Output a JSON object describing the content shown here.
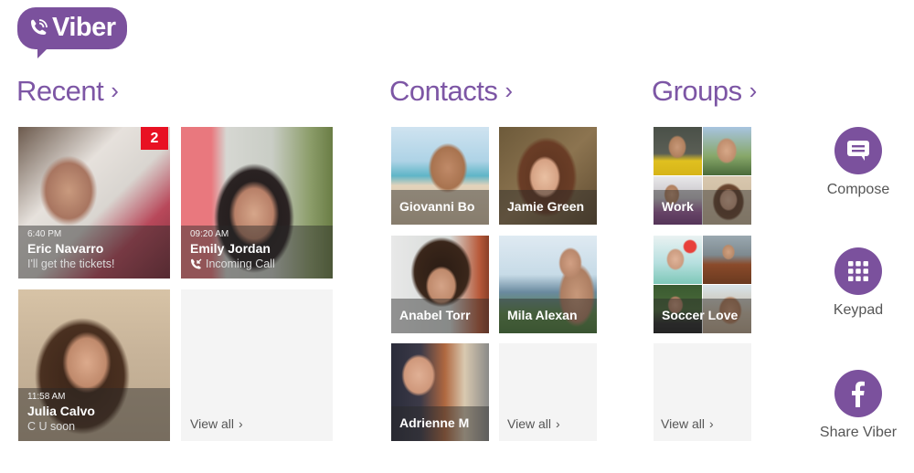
{
  "app": {
    "logo_text": "Viber",
    "brand_color": "#7b519d",
    "accent_badge_color": "#e81123"
  },
  "sections": {
    "recent": {
      "title": "Recent",
      "chevron": "›"
    },
    "contacts": {
      "title": "Contacts",
      "chevron": "›"
    },
    "groups": {
      "title": "Groups",
      "chevron": "›"
    }
  },
  "recent": {
    "items": [
      {
        "time": "6:40 PM",
        "name": "Eric Navarro",
        "message": "I'll get the tickets!",
        "unread_count": "2"
      },
      {
        "time": "09:20 AM",
        "name": "Emily Jordan",
        "message": "Incoming Call",
        "message_icon": "incoming-call-icon"
      },
      {
        "time": "11:58 AM",
        "name": "Julia Calvo",
        "message": "C U soon"
      }
    ],
    "view_all": "View all",
    "view_all_chevron": "›"
  },
  "contacts": {
    "items": [
      {
        "name": "Giovanni Bo"
      },
      {
        "name": "Jamie Green"
      },
      {
        "name": "Anabel Torr"
      },
      {
        "name": "Mila Alexan"
      },
      {
        "name": "Adrienne M"
      }
    ],
    "view_all": "View all",
    "view_all_chevron": "›"
  },
  "groups": {
    "items": [
      {
        "name": "Work"
      },
      {
        "name": "Soccer Love"
      }
    ],
    "view_all": "View all",
    "view_all_chevron": "›"
  },
  "actions": [
    {
      "label": "Compose",
      "icon": "compose-icon"
    },
    {
      "label": "Keypad",
      "icon": "keypad-icon"
    },
    {
      "label": "Share Viber",
      "icon": "facebook-icon"
    }
  ]
}
